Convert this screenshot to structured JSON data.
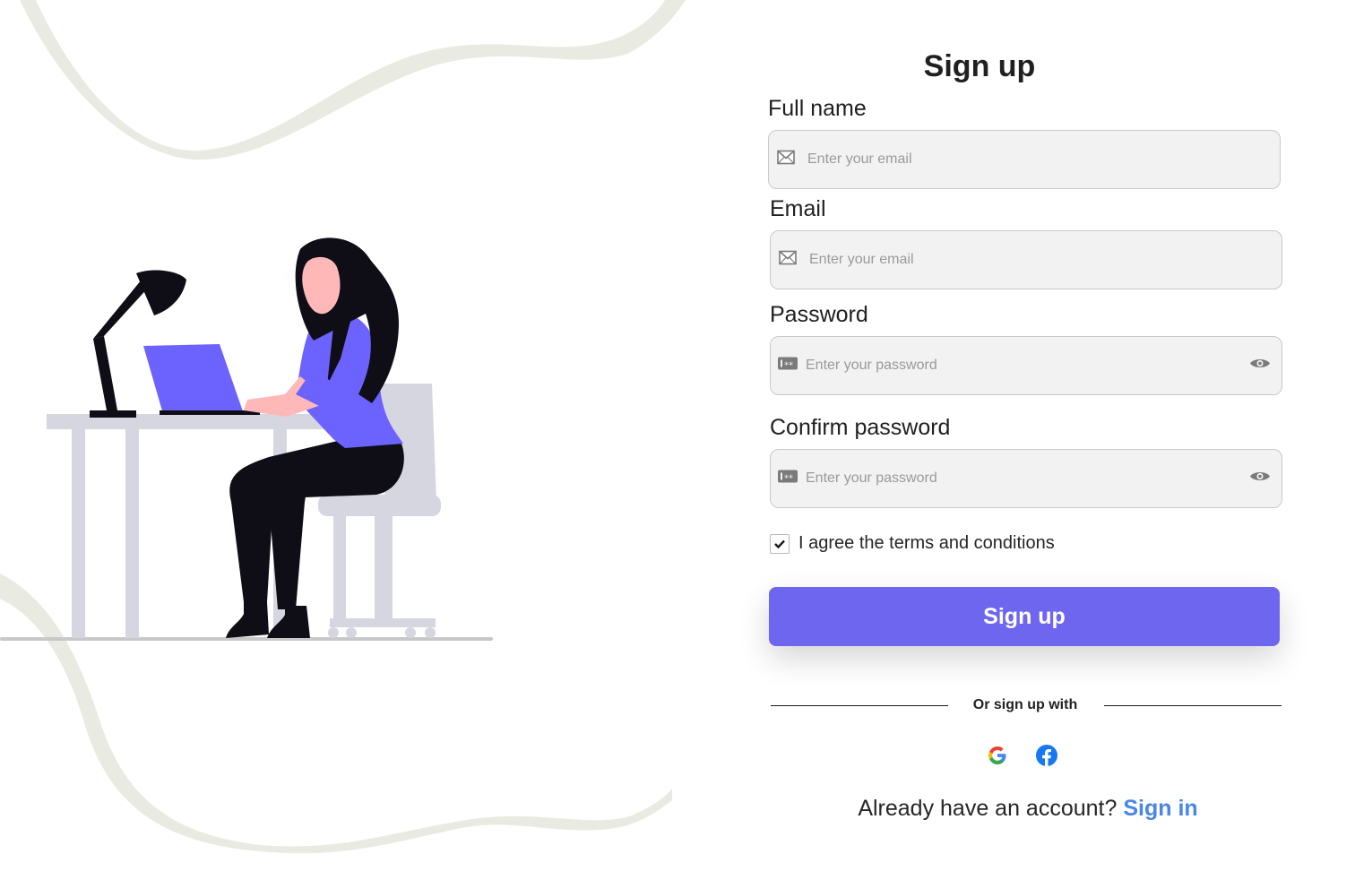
{
  "form": {
    "title": "Sign up",
    "full_name": {
      "label": "Full name",
      "placeholder": "Enter your email"
    },
    "email": {
      "label": "Email",
      "placeholder": "Enter your email"
    },
    "password": {
      "label": "Password",
      "placeholder": "Enter your password"
    },
    "confirm_password": {
      "label": "Confirm password",
      "placeholder": "Enter your password"
    },
    "terms": {
      "label": "I agree the terms and conditions",
      "checked": true
    },
    "submit_label": "Sign up",
    "divider_text": "Or sign up with",
    "social": [
      "google-icon",
      "facebook-icon"
    ],
    "footer": {
      "prompt": "Already have an account?",
      "link_label": "Sign in"
    }
  },
  "colors": {
    "accent": "#6f66f0",
    "link": "#4a86e8",
    "field_bg": "#f2f2f2",
    "illustration_purple": "#6c63ff",
    "illustration_gray": "#d6d6e1"
  }
}
